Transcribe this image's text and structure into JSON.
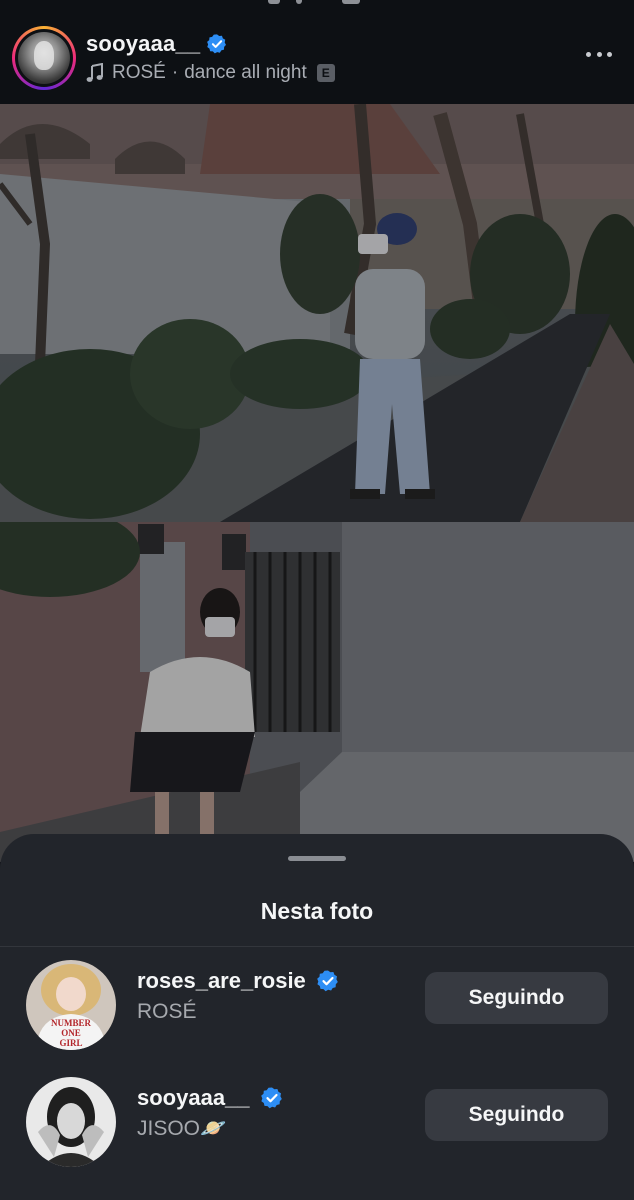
{
  "post": {
    "username": "sooyaaa__",
    "music": {
      "artist": "ROSÉ",
      "separator": "·",
      "song": "dance all night",
      "explicit_badge": "E"
    }
  },
  "sheet": {
    "title": "Nesta foto",
    "people": [
      {
        "username": "roses_are_rosie",
        "name": "ROSÉ",
        "button_label": "Seguindo"
      },
      {
        "username": "sooyaaa__",
        "name": "JISOO",
        "name_emoji": "🪐",
        "button_label": "Seguindo"
      }
    ]
  },
  "avatar_shirt_text": [
    "NUMBER",
    "ONE",
    "GIRL"
  ],
  "colors": {
    "verified_blue": "#2d8ef5",
    "sheet_bg": "#22252b",
    "button_bg": "#373a41",
    "secondary_text": "#a6a9ae"
  },
  "icons": [
    "music-note-icon",
    "verified-badge-icon",
    "more-options-icon"
  ]
}
